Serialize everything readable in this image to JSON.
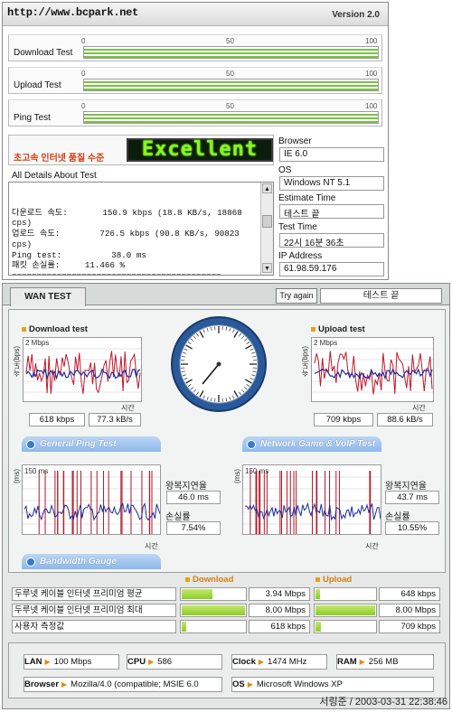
{
  "header": {
    "url": "http://www.bcpark.net",
    "version": "Version 2.0"
  },
  "tests": {
    "scale": [
      "0",
      "50",
      "100"
    ],
    "rows": [
      {
        "label": "Download Test"
      },
      {
        "label": "Upload Test"
      },
      {
        "label": "Ping Test"
      }
    ]
  },
  "quality": {
    "label": "초고속 인터넷 품질 수준",
    "display": "Excellent"
  },
  "details": {
    "title": "All Details About Test",
    "text": "\n다운로드 속도:       150.9 kbps (18.8 KB/s, 18868\ncps)\n업로드 속도:        726.5 kbps (90.8 KB/s, 90823\ncps)\nPing test:          38.0 ms\n패킷 손실률:     11.466 %\n=========================================="
  },
  "info": {
    "browser_label": "Browser",
    "browser": "IE 6.0",
    "os_label": "OS",
    "os": "Windows NT 5.1",
    "estimate_label": "Estimate Time",
    "estimate": "테스트 끝",
    "testtime_label": "Test Time",
    "testtime": "22시 16분 36초",
    "ip_label": "IP Address",
    "ip": "61.98.59.176"
  },
  "wan": {
    "tab": "WAN TEST",
    "try_again": "Try again",
    "result": "테스트 끝",
    "download": {
      "title": "Download test",
      "ylabel": "속도(bps)",
      "ymax": "2 Mbps",
      "xlabel": "시간",
      "kbps": "618 kbps",
      "kBs": "77.3 kB/s"
    },
    "upload": {
      "title": "Upload test",
      "ylabel": "속도(bps)",
      "ymax": "2 Mbps",
      "xlabel": "시간",
      "kbps": "709 kbps",
      "kBs": "88.6 kB/s"
    },
    "general_ping": {
      "title": "General Ping Test",
      "ylabel": "(ms)",
      "ymax": "150 ms",
      "xlabel": "시간",
      "rtt_label": "왕복지연율",
      "rtt": "46.0 ms",
      "loss_label": "손실률",
      "loss": "7.54%"
    },
    "game_ping": {
      "title": "Network Game & VoIP Test",
      "ylabel": "(ms)",
      "ymax": "150 ms",
      "xlabel": "시간",
      "rtt_label": "왕복지연율",
      "rtt": "43.7 ms",
      "loss_label": "손실률",
      "loss": "10.55%"
    },
    "bandwidth_title": "Bandwidth Gauge",
    "gauge": {
      "download_head": "Download",
      "upload_head": "Upload",
      "rows": [
        {
          "name": "두루넷 케이블 인터넷 프리미엄 평균",
          "down": "3.94 Mbps",
          "down_frac": 0.49,
          "up": "648 kbps",
          "up_frac": 0.08
        },
        {
          "name": "두루넷 케이블 인터넷 프리미엄 최대",
          "down": "8.00 Mbps",
          "down_frac": 1.0,
          "up": "8.00 Mbps",
          "up_frac": 1.0
        },
        {
          "name": "사용자 측정값",
          "down": "618 kbps",
          "down_frac": 0.077,
          "up": "709 kbps",
          "up_frac": 0.089
        }
      ]
    }
  },
  "system": {
    "lan_label": "LAN",
    "lan": "100 Mbps",
    "cpu_label": "CPU",
    "cpu": "586",
    "clock_label": "Clock",
    "clock": "1474 MHz",
    "ram_label": "RAM",
    "ram": "256 MB",
    "browser_label": "Browser",
    "browser": "Mozilla/4.0 (compatible; MSIE 6.0",
    "os_label": "OS",
    "os": "Microsoft Windows XP"
  },
  "stamp": "서링준 / 2003-03-31 22:38:46",
  "colors": {
    "bar_green": "#7cc04a",
    "led_text": "#7fff1a",
    "series_red": "#c0182a",
    "series_blue": "#1a2ea0",
    "accent_orange": "#e8a020"
  }
}
